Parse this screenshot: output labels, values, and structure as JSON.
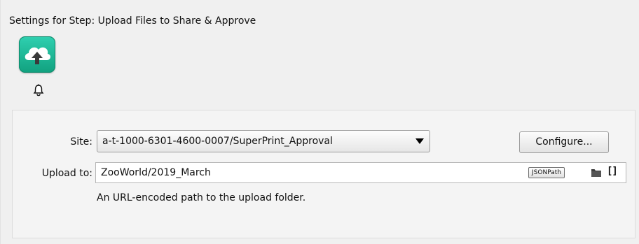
{
  "header": {
    "title": "Settings for Step: Upload Files to Share & Approve",
    "step_icon": "cloud-upload-icon",
    "notification_icon": "bell-icon"
  },
  "form": {
    "site": {
      "label": "Site:",
      "selected_value": "a-t-1000-6301-4600-0007/SuperPrint_Approval"
    },
    "configure_button_label": "Configure...",
    "upload_to": {
      "label": "Upload to:",
      "value": "ZooWorld/2019_March",
      "jsonpath_label": "JSONPath",
      "folder_icon": "folder-icon",
      "brackets_label": "[]",
      "hint": "An URL-encoded path to the upload folder."
    }
  },
  "colors": {
    "step_icon_bg": "#1bb593",
    "background": "#f0f0f0"
  }
}
